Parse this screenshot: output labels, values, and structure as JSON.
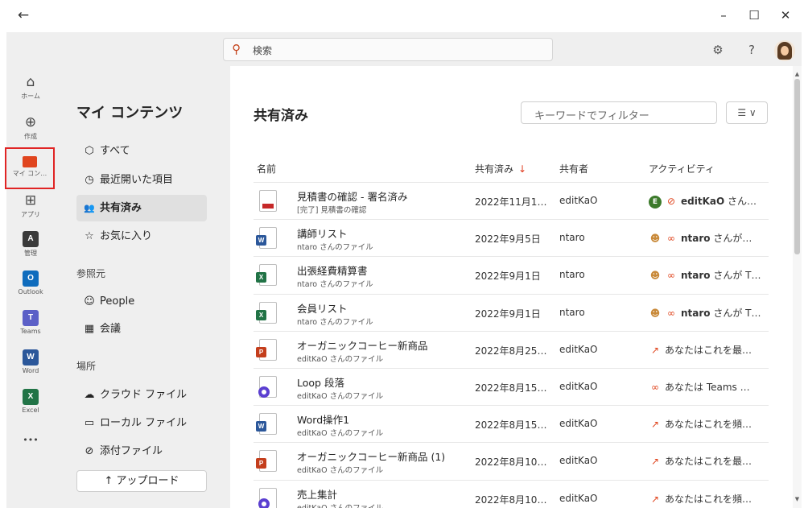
{
  "titlebar": {
    "back": "←",
    "minimize": "–",
    "maximize": "☐",
    "close": "✕"
  },
  "header": {
    "search_placeholder": "検索",
    "settings": "⚙",
    "help": "?"
  },
  "rail": [
    {
      "label": "ホーム",
      "icon": "⌂"
    },
    {
      "label": "作成",
      "icon": "⊕"
    },
    {
      "label": "マイ コン…",
      "icon": "folder"
    },
    {
      "label": "アプリ",
      "icon": "⊞"
    },
    {
      "label": "管理",
      "icon": "A"
    },
    {
      "label": "Outlook",
      "icon": "O"
    },
    {
      "label": "Teams",
      "icon": "T"
    },
    {
      "label": "Word",
      "icon": "W"
    },
    {
      "label": "Excel",
      "icon": "X"
    },
    {
      "label": "",
      "icon": "•••"
    }
  ],
  "nav": {
    "title": "マイ コンテンツ",
    "items": [
      {
        "label": "すべて",
        "icon": "⬡"
      },
      {
        "label": "最近開いた項目",
        "icon": "◷"
      },
      {
        "label": "共有済み",
        "icon": "👥"
      },
      {
        "label": "お気に入り",
        "icon": "☆"
      }
    ],
    "section_ref": "参照元",
    "ref_items": [
      {
        "label": "People",
        "icon": "☺"
      },
      {
        "label": "会議",
        "icon": "▦"
      }
    ],
    "section_place": "場所",
    "place_items": [
      {
        "label": "クラウド ファイル",
        "icon": "☁"
      },
      {
        "label": "ローカル ファイル",
        "icon": "▭"
      },
      {
        "label": "添付ファイル",
        "icon": "⊘"
      }
    ],
    "upload": "↑ アップロード"
  },
  "main": {
    "title": "共有済み",
    "filter_placeholder": "キーワードでフィルター",
    "sort_button": "☰ ∨",
    "columns": {
      "name": "名前",
      "shared": "共有済み",
      "sort_arrow": "↓",
      "by": "共有者",
      "activity": "アクティビティ"
    },
    "rows": [
      {
        "type": "pdf",
        "name": "見積書の確認 - 署名済み",
        "sub": "[完了] 見積書の確認",
        "date": "2022年11月1…",
        "by": "editKaO",
        "activity_icon": "E",
        "activity_bold": "editKaO",
        "activity_rest": " さん…"
      },
      {
        "type": "word",
        "name": "講師リスト",
        "sub": "ntaro さんのファイル",
        "date": "2022年9月5日",
        "by": "ntaro",
        "activity_icon": "people",
        "activity_bold": "ntaro",
        "activity_rest": " さんが…"
      },
      {
        "type": "excel",
        "name": "出張経費精算書",
        "sub": "ntaro さんのファイル",
        "date": "2022年9月1日",
        "by": "ntaro",
        "activity_icon": "people",
        "activity_bold": "ntaro",
        "activity_rest": " さんが T…"
      },
      {
        "type": "excel",
        "name": "会員リスト",
        "sub": "ntaro さんのファイル",
        "date": "2022年9月1日",
        "by": "ntaro",
        "activity_icon": "people",
        "activity_bold": "ntaro",
        "activity_rest": " さんが T…"
      },
      {
        "type": "ppt",
        "name": "オーガニックコーヒー新商品",
        "sub": "editKaO さんのファイル",
        "date": "2022年8月25…",
        "by": "editKaO",
        "activity_icon": "open",
        "activity_bold": "",
        "activity_rest": "あなたはこれを最…"
      },
      {
        "type": "loop",
        "name": "Loop 段落",
        "sub": "editKaO さんのファイル",
        "date": "2022年8月15…",
        "by": "editKaO",
        "activity_icon": "group",
        "activity_bold": "",
        "activity_rest": "あなたは Teams …"
      },
      {
        "type": "word",
        "name": "Word操作1",
        "sub": "editKaO さんのファイル",
        "date": "2022年8月15…",
        "by": "editKaO",
        "activity_icon": "open",
        "activity_bold": "",
        "activity_rest": "あなたはこれを頻…"
      },
      {
        "type": "ppt",
        "name": "オーガニックコーヒー新商品 (1)",
        "sub": "editKaO さんのファイル",
        "date": "2022年8月10…",
        "by": "editKaO",
        "activity_icon": "open",
        "activity_bold": "",
        "activity_rest": "あなたはこれを最…"
      },
      {
        "type": "loop",
        "name": "売上集計",
        "sub": "editKaO さんのファイル",
        "date": "2022年8月10…",
        "by": "editKaO",
        "activity_icon": "open",
        "activity_bold": "",
        "activity_rest": "あなたはこれを頻…"
      }
    ]
  },
  "colors": {
    "word": "#2b579a",
    "excel": "#217346",
    "ppt": "#c43e1c",
    "loop": "#5b3fd1",
    "accent": "#e0451e",
    "active_border": "#e02424"
  }
}
